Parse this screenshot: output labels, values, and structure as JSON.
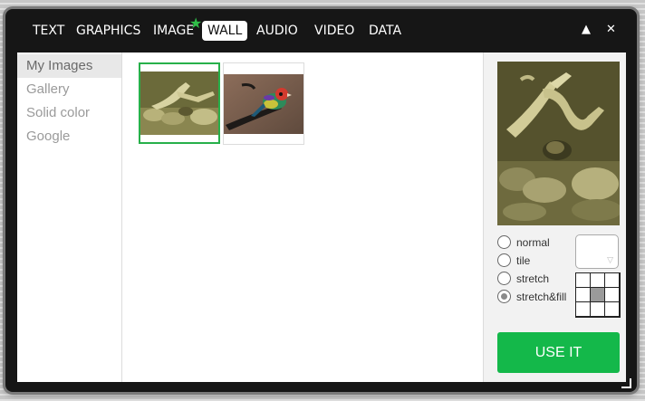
{
  "tabs": [
    {
      "label": "TEXT"
    },
    {
      "label": "GRAPHICS"
    },
    {
      "label": "IMAGE"
    },
    {
      "label": "WALL"
    },
    {
      "label": "AUDIO"
    },
    {
      "label": "VIDEO"
    },
    {
      "label": "DATA"
    }
  ],
  "active_tab": "WALL",
  "window_controls": {
    "collapse": "▲",
    "close": "✕"
  },
  "sidebar": {
    "items": [
      {
        "label": "My Images"
      },
      {
        "label": "Gallery"
      },
      {
        "label": "Solid color"
      },
      {
        "label": "Google"
      }
    ]
  },
  "images": [
    {
      "name": "driftwood",
      "selected": true
    },
    {
      "name": "bird",
      "selected": false
    }
  ],
  "fill_options": [
    {
      "label": "normal"
    },
    {
      "label": "tile"
    },
    {
      "label": "stretch"
    },
    {
      "label": "stretch&fill"
    }
  ],
  "selected_fill": "stretch&fill",
  "use_button": "USE IT",
  "colors": {
    "accent": "#14b84a",
    "selected_border": "#27b04a",
    "star": "#2fbf48"
  }
}
